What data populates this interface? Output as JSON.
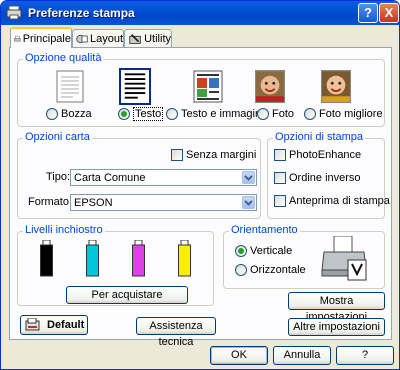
{
  "window": {
    "title": "Preferenze stampa",
    "help_label": "?",
    "close_label": "X"
  },
  "tabs": [
    {
      "label": "Principale",
      "icon": "printer-paper-icon",
      "active": true
    },
    {
      "label": "Layout",
      "icon": "layout-icon",
      "active": false
    },
    {
      "label": "Utility",
      "icon": "utility-icon",
      "active": false
    }
  ],
  "quality": {
    "group_label": "Opzione qualità",
    "options": [
      {
        "label": "Bozza",
        "selected": false
      },
      {
        "label": "Testo",
        "selected": true
      },
      {
        "label": "Testo e immagine",
        "selected": false
      },
      {
        "label": "Foto",
        "selected": false
      },
      {
        "label": "Foto migliore",
        "selected": false
      }
    ]
  },
  "paper": {
    "group_label": "Opzioni carta",
    "borderless_label": "Senza margini",
    "type_label": "Tipo:",
    "type_value": "Carta Comune",
    "format_label": "Formato:",
    "format_value": "EPSON"
  },
  "print_options": {
    "group_label": "Opzioni di stampa",
    "items": [
      {
        "label": "PhotoEnhance",
        "checked": false
      },
      {
        "label": "Ordine inverso",
        "checked": false
      },
      {
        "label": "Anteprima di stampa",
        "checked": false
      }
    ]
  },
  "ink": {
    "group_label": "Livelli inchiostro",
    "colors": [
      "#000000",
      "#00c8d8",
      "#e040e8",
      "#f8f000"
    ],
    "buy_label": "Per acquistare"
  },
  "orientation": {
    "group_label": "Orientamento",
    "options": [
      {
        "label": "Verticale",
        "selected": true
      },
      {
        "label": "Orizzontale",
        "selected": false
      }
    ]
  },
  "buttons": {
    "show_settings": "Mostra impostazioni",
    "more_settings": "Altre impostazioni",
    "default": "Default",
    "support": "Assistenza tecnica",
    "ok": "OK",
    "cancel": "Annulla",
    "help": "?"
  }
}
